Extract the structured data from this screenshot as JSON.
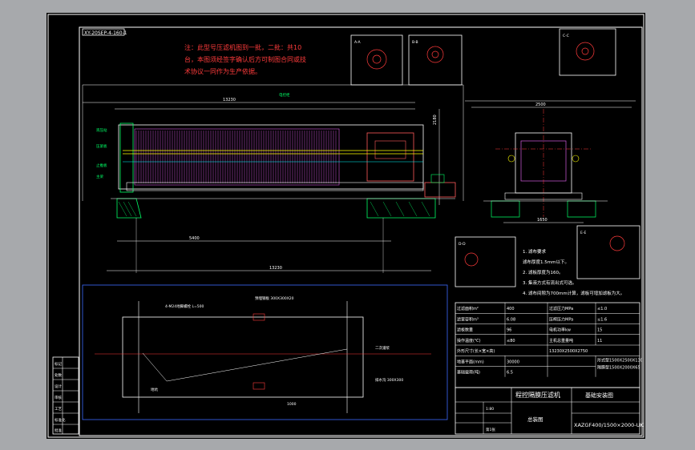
{
  "drawing_no_top": "XY-20SEP-4-160-1",
  "note_red": [
    "注：此型号压滤机图到一批，二批：共10",
    "台，本图须经签字确认后方可制图合同或技",
    "术协议一同作为生产依据。"
  ],
  "tech_notes": [
    "1. 滤布要求",
    "滤布厚度1.5mm以下。",
    "2. 滤板厚度为160。",
    "3. 集液方式有流出式可选。",
    "4. 滤布间隙为700mm计算，滤板可增加滤板为大。"
  ],
  "section_labels": {
    "a": "A-A",
    "b": "B-B",
    "c": "C-C",
    "d": "D-D",
    "e": "E-E",
    "f": "F-F"
  },
  "dims": {
    "overall": "13230",
    "pitch": "5400",
    "width": "2500",
    "height": "2180",
    "base": "1650",
    "d1": "1000",
    "d2": "980",
    "d3": "550"
  },
  "spec_table": [
    [
      "过滤面积m²",
      "400",
      "过滤压力MPa",
      "≤1.0"
    ],
    [
      "滤室容积m³",
      "6.08",
      "压榨压力MPa",
      "≤1.6"
    ],
    [
      "滤板数量",
      "96",
      "电机功率kw",
      "15"
    ],
    [
      "操作温度(℃)",
      "≤80",
      "主机总重量吨",
      "11"
    ]
  ],
  "spec_extra": {
    "size_label": "外形尺寸(长×宽×高)",
    "size_value": "13230X2500X2750",
    "foundation_label": "地基平面(mm)",
    "foundation_value": "30000",
    "load_label": "基础载荷(吨)",
    "load_value": "6.5",
    "model_a": "形式型1500X2500X130",
    "model_b": "隔膜型1500X2000X65"
  },
  "title_block": {
    "product": "程控隔膜压滤机",
    "sheet_name": "基础安装图",
    "drawing_name": "总装图",
    "model": "XAZGF400/1500×2000-UK",
    "scale": "1:80",
    "sheet": "第1张"
  },
  "callouts": [
    "液压站",
    "压紧板",
    "止推板",
    "主梁",
    "电控柜",
    "集液槽",
    "预埋件"
  ],
  "left_column": [
    "标记",
    "处数",
    "设计",
    "审核",
    "工艺",
    "标准化",
    "批准"
  ],
  "plan_notes": [
    "4-M24地脚螺栓 L=500",
    "预埋钢板 300X300X20",
    "二次灌浆",
    "排水沟 300X300",
    "地坑"
  ]
}
